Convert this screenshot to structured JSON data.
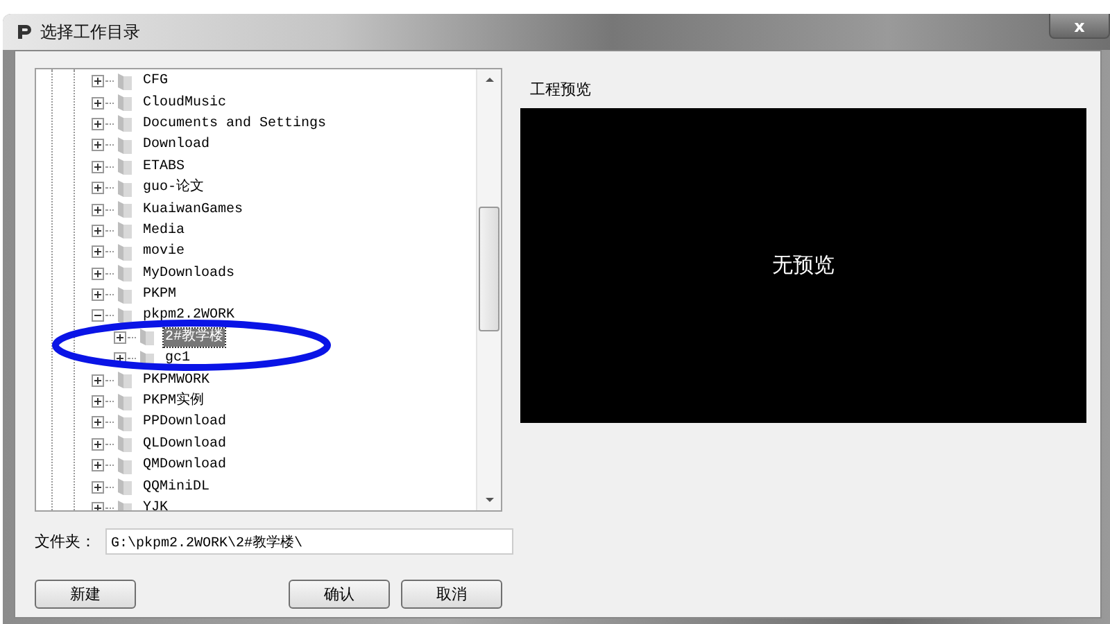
{
  "window": {
    "title": "选择工作目录",
    "close": "x"
  },
  "tree": {
    "items": [
      {
        "label": "CFG",
        "expanded": false,
        "selected": false
      },
      {
        "label": "CloudMusic",
        "expanded": false,
        "selected": false
      },
      {
        "label": "Documents and Settings",
        "expanded": false,
        "selected": false
      },
      {
        "label": "Download",
        "expanded": false,
        "selected": false
      },
      {
        "label": "ETABS",
        "expanded": false,
        "selected": false
      },
      {
        "label": "guo-论文",
        "expanded": false,
        "selected": false
      },
      {
        "label": "KuaiwanGames",
        "expanded": false,
        "selected": false
      },
      {
        "label": "Media",
        "expanded": false,
        "selected": false
      },
      {
        "label": "movie",
        "expanded": false,
        "selected": false
      },
      {
        "label": "MyDownloads",
        "expanded": false,
        "selected": false
      },
      {
        "label": "PKPM",
        "expanded": false,
        "selected": false
      },
      {
        "label": "pkpm2.2WORK",
        "expanded": true,
        "selected": false,
        "children": [
          {
            "label": "2#教学楼",
            "expanded": false,
            "selected": true
          },
          {
            "label": "gc1",
            "expanded": false,
            "selected": false
          }
        ]
      },
      {
        "label": "PKPMWORK",
        "expanded": false,
        "selected": false
      },
      {
        "label": "PKPM实例",
        "expanded": false,
        "selected": false
      },
      {
        "label": "PPDownload",
        "expanded": false,
        "selected": false
      },
      {
        "label": "QLDownload",
        "expanded": false,
        "selected": false
      },
      {
        "label": "QMDownload",
        "expanded": false,
        "selected": false
      },
      {
        "label": "QQMiniDL",
        "expanded": false,
        "selected": false
      },
      {
        "label": "YJK",
        "expanded": false,
        "selected": false
      }
    ]
  },
  "preview": {
    "label": "工程预览",
    "empty_text": "无预览"
  },
  "folder": {
    "label": "文件夹：",
    "value": "G:\\pkpm2.2WORK\\2#教学楼\\"
  },
  "buttons": [
    {
      "label": "新建",
      "kind": "left"
    },
    {
      "label": "确认",
      "kind": "right"
    },
    {
      "label": "取消",
      "kind": "right"
    }
  ]
}
